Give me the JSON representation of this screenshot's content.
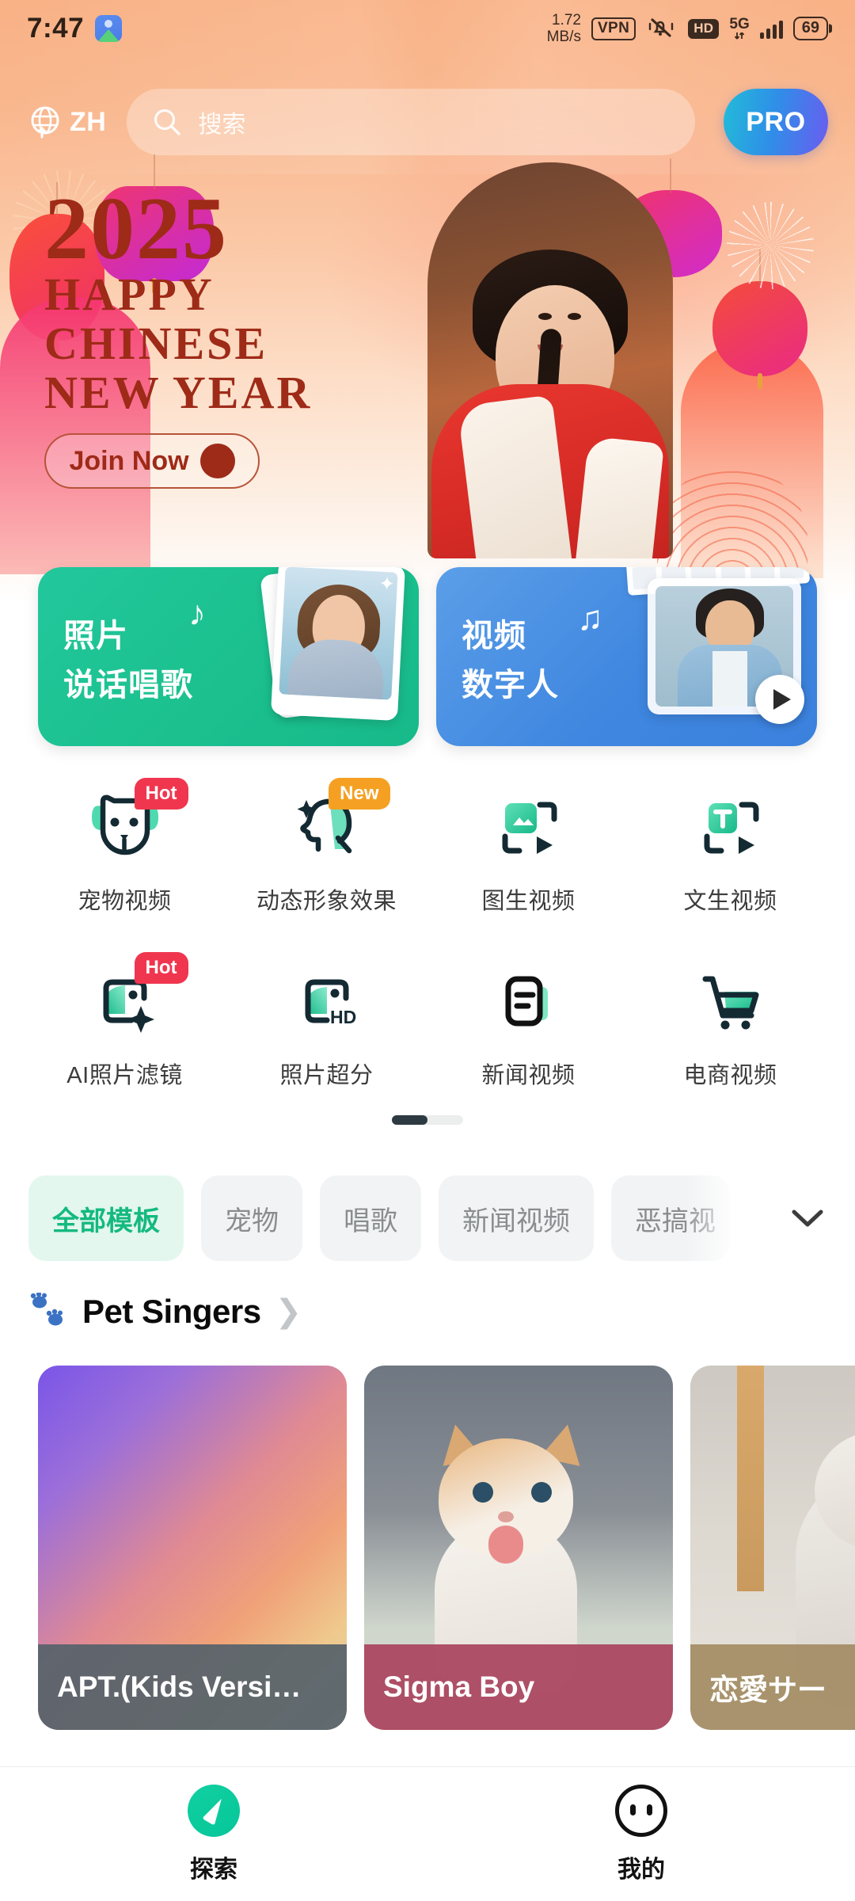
{
  "status_bar": {
    "time": "7:47",
    "app_icon": "android-app-icon",
    "net_speed_value": "1.72",
    "net_speed_unit": "MB/s",
    "vpn_label": "VPN",
    "mute_icon": "bell-muted-icon",
    "hd_label": "HD",
    "network_label": "5G",
    "signal_icon": "signal-bars-icon",
    "battery_level": "69"
  },
  "header": {
    "language_icon": "globe-icon",
    "language_label": "ZH",
    "search_icon": "search-icon",
    "search_placeholder": "搜索",
    "search_value": "",
    "pro_label": "PRO"
  },
  "banner": {
    "year": "2025",
    "line1": "HAPPY",
    "line2": "CHINESE",
    "line3": "NEW YEAR",
    "cta_label": "Join Now",
    "cta_icon": "chevron-right-circle-icon",
    "decor": [
      "lantern-icon",
      "firework-icon",
      "pillar-decor"
    ]
  },
  "feature_cards": [
    {
      "title_line1": "照片",
      "title_line2": "说话唱歌",
      "note_icon": "music-note-icon",
      "color": "#1cc18f",
      "thumb": "woman-photo-thumb"
    },
    {
      "title_line1": "视频",
      "title_line2": "数字人",
      "note_icon": "music-notes-icon",
      "color": "#3f87e0",
      "thumb": "man-video-thumb",
      "play_icon": "play-icon"
    }
  ],
  "icon_grid": {
    "rows": [
      [
        {
          "label": "宠物视频",
          "icon": "dog-face-icon",
          "badge": "Hot",
          "badge_type": "hot"
        },
        {
          "label": "动态形象效果",
          "icon": "head-sparkle-icon",
          "badge": "New",
          "badge_type": "new"
        },
        {
          "label": "图生视频",
          "icon": "image-to-video-icon",
          "badge": "",
          "badge_type": ""
        },
        {
          "label": "文生视频",
          "icon": "text-to-video-icon",
          "badge": "",
          "badge_type": ""
        }
      ],
      [
        {
          "label": "AI照片滤镜",
          "icon": "photo-filter-sparkle-icon",
          "badge": "Hot",
          "badge_type": "hot"
        },
        {
          "label": "照片超分",
          "icon": "photo-hd-icon",
          "badge": "",
          "badge_type": ""
        },
        {
          "label": "新闻视频",
          "icon": "news-document-icon",
          "badge": "",
          "badge_type": ""
        },
        {
          "label": "电商视频",
          "icon": "shopping-cart-icon",
          "badge": "",
          "badge_type": ""
        }
      ]
    ],
    "page_indicator": "scroll-indicator"
  },
  "filter_chips": {
    "items": [
      {
        "label": "全部模板",
        "active": true
      },
      {
        "label": "宠物",
        "active": false
      },
      {
        "label": "唱歌",
        "active": false
      },
      {
        "label": "新闻视频",
        "active": false
      },
      {
        "label": "恶搞视",
        "active": false
      }
    ],
    "expand_icon": "chevron-down-icon"
  },
  "section": {
    "icon": "paw-prints-icon",
    "title": "Pet Singers",
    "chevron": "chevron-right-icon"
  },
  "template_cards": [
    {
      "title": "APT.(Kids Versi…",
      "media": "gradient-placeholder",
      "caption_color": "#56626a"
    },
    {
      "title": "Sigma Boy",
      "media": "kitten-photo",
      "caption_color": "#aa4660"
    },
    {
      "title": "恋愛サー",
      "media": "ragdoll-cat-photo",
      "caption_color": "#a48e67"
    }
  ],
  "bottom_nav": [
    {
      "label": "探索",
      "icon": "compass-icon",
      "active": true
    },
    {
      "label": "我的",
      "icon": "profile-face-icon",
      "active": false
    }
  ],
  "colors": {
    "accent_green": "#14b981",
    "hot_badge": "#f0364f",
    "new_badge": "#f5a022",
    "hero_top": "#f9b185",
    "cny_red": "#9e2a18"
  }
}
